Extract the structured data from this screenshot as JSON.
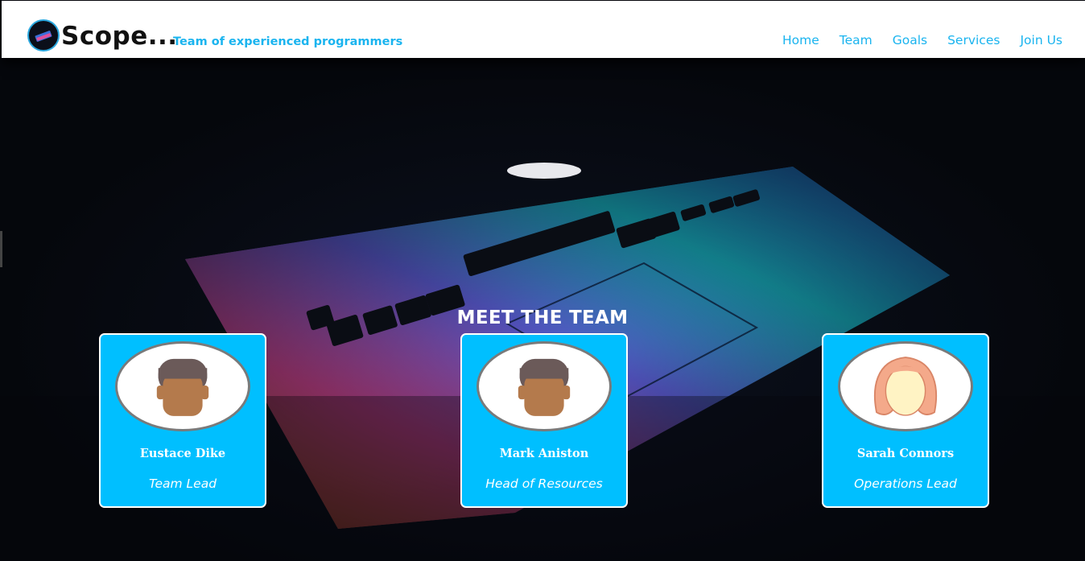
{
  "header": {
    "brand": "Scope...",
    "tagline": "Team of experienced programmers",
    "nav": [
      "Home",
      "Team",
      "Goals",
      "Services",
      "Join Us"
    ]
  },
  "team": {
    "title": "MEET THE TEAM",
    "members": [
      {
        "name": "Eustace Dike",
        "role": "Team Lead",
        "avatar_icon": "male-avatar-icon"
      },
      {
        "name": "Mark Aniston",
        "role": "Head of Resources",
        "avatar_icon": "male-avatar-icon"
      },
      {
        "name": "Sarah Connors",
        "role": "Operations Lead",
        "avatar_icon": "female-avatar-icon"
      }
    ]
  },
  "colors": {
    "accent": "#1ab4ef",
    "card_bg": "#00bfff",
    "header_bg": "#ffffff",
    "hero_bg": "#05070c"
  }
}
